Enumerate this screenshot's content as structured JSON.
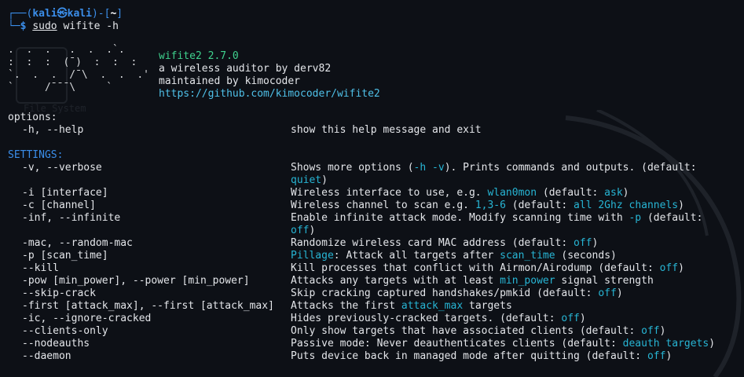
{
  "prompt": {
    "user": "kali",
    "host": "kali",
    "dir": "~",
    "sudo": "sudo",
    "command": " wifite -h"
  },
  "banner": {
    "art": ".  .  .   .  .  .`.\n:  :  :  (¯)  :  :  :\n`.  .  .  /¯\\  .  .  .'\n`     /¯¯¯\\     `",
    "name": "wifite2 2.7.0",
    "desc": "a wireless auditor by derv82",
    "maint": "maintained by kimocoder",
    "url": "https://github.com/kimocoder/wifite2"
  },
  "sections": {
    "options": "options:",
    "settings": "SETTINGS:"
  },
  "rows": [
    {
      "opt": "-h, --help",
      "desc": [
        "show this help message and exit"
      ]
    },
    {
      "opt": "-v, --verbose",
      "desc": [
        "Shows more options (",
        {
          "c": "-h -v"
        },
        "). Prints commands and outputs. (default:"
      ],
      "cont": {
        "c": "quiet"
      },
      "cont_after": ")"
    },
    {
      "opt": "-i [interface]",
      "desc": [
        "Wireless interface to use, e.g. ",
        {
          "c": "wlan0mon"
        },
        " (default: ",
        {
          "c": "ask"
        },
        ")"
      ]
    },
    {
      "opt": "-c [channel]",
      "desc": [
        "Wireless channel to scan e.g. ",
        {
          "c": "1,3-6"
        },
        " (default: ",
        {
          "c": "all 2Ghz channels"
        },
        ")"
      ]
    },
    {
      "opt": "-inf, --infinite",
      "desc": [
        "Enable infinite attack mode. Modify scanning time with ",
        {
          "c": "-p"
        },
        " (default:"
      ],
      "cont": {
        "c": "off"
      },
      "cont_after": ")"
    },
    {
      "opt": "-mac, --random-mac",
      "desc": [
        "Randomize wireless card MAC address (default: ",
        {
          "c": "off"
        },
        ")"
      ]
    },
    {
      "opt": "-p [scan_time]",
      "desc": [
        {
          "c": "Pillage"
        },
        ": Attack all targets after ",
        {
          "c": "scan_time"
        },
        " (seconds)"
      ]
    },
    {
      "opt": "--kill",
      "desc": [
        "Kill processes that conflict with Airmon/Airodump (default: ",
        {
          "c": "off"
        },
        ")"
      ]
    },
    {
      "opt": "-pow [min_power], --power [min_power]",
      "desc": [
        "Attacks any targets with at least ",
        {
          "c": "min_power"
        },
        " signal strength"
      ]
    },
    {
      "opt": "--skip-crack",
      "desc": [
        "Skip cracking captured handshakes/pmkid (default: ",
        {
          "c": "off"
        },
        ")"
      ]
    },
    {
      "opt": "-first [attack_max], --first [attack_max]",
      "desc": [
        "Attacks the first ",
        {
          "c": "attack_max"
        },
        " targets"
      ]
    },
    {
      "opt": "-ic, --ignore-cracked",
      "desc": [
        "Hides previously-cracked targets. (default: ",
        {
          "c": "off"
        },
        ")"
      ]
    },
    {
      "opt": "--clients-only",
      "desc": [
        "Only show targets that have associated clients (default: ",
        {
          "c": "off"
        },
        ")"
      ]
    },
    {
      "opt": "--nodeauths",
      "desc": [
        "Passive mode: Never deauthenticates clients (default: ",
        {
          "c": "deauth targets"
        },
        ")"
      ]
    },
    {
      "opt": "--daemon",
      "desc": [
        "Puts device back in managed mode after quitting (default: ",
        {
          "c": "off"
        },
        ")"
      ]
    }
  ],
  "background": {
    "icon_label": "File System"
  },
  "colors": {
    "background": "#0d1016",
    "accent_blue": "#3b8eea",
    "value_cyan": "#27b5d4",
    "version_green": "#3fd28e"
  }
}
